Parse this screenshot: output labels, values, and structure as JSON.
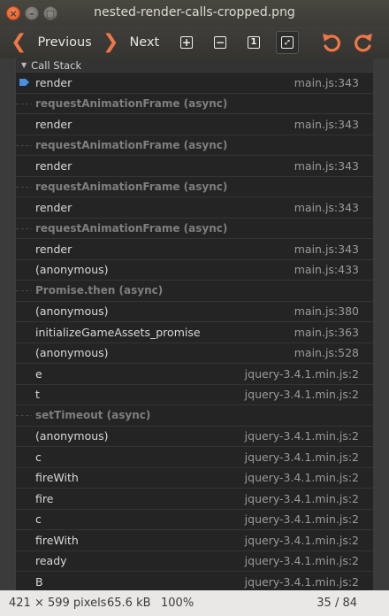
{
  "window": {
    "title": "nested-render-calls-cropped.png",
    "close_glyph": "×",
    "min_glyph": "–",
    "max_glyph": "□"
  },
  "toolbar": {
    "previous_label": "Previous",
    "next_label": "Next",
    "accent_color": "#f07746",
    "tools": [
      "zoom-in-icon",
      "zoom-out-icon",
      "normal-size-icon",
      "best-fit-icon"
    ],
    "rotate": [
      "rotate-left-icon",
      "rotate-right-icon"
    ]
  },
  "call_stack": {
    "header": "Call Stack",
    "frames": [
      {
        "name": "render",
        "location": "main.js:343",
        "type": "frame",
        "selected": true
      },
      {
        "name": "requestAnimationFrame (async)",
        "location": "",
        "type": "async"
      },
      {
        "name": "render",
        "location": "main.js:343",
        "type": "frame"
      },
      {
        "name": "requestAnimationFrame (async)",
        "location": "",
        "type": "async"
      },
      {
        "name": "render",
        "location": "main.js:343",
        "type": "frame"
      },
      {
        "name": "requestAnimationFrame (async)",
        "location": "",
        "type": "async"
      },
      {
        "name": "render",
        "location": "main.js:343",
        "type": "frame"
      },
      {
        "name": "requestAnimationFrame (async)",
        "location": "",
        "type": "async"
      },
      {
        "name": "render",
        "location": "main.js:343",
        "type": "frame"
      },
      {
        "name": "(anonymous)",
        "location": "main.js:433",
        "type": "frame"
      },
      {
        "name": "Promise.then (async)",
        "location": "",
        "type": "async"
      },
      {
        "name": "(anonymous)",
        "location": "main.js:380",
        "type": "frame"
      },
      {
        "name": "initializeGameAssets_promise",
        "location": "main.js:363",
        "type": "frame"
      },
      {
        "name": "(anonymous)",
        "location": "main.js:528",
        "type": "frame"
      },
      {
        "name": "e",
        "location": "jquery-3.4.1.min.js:2",
        "type": "frame"
      },
      {
        "name": "t",
        "location": "jquery-3.4.1.min.js:2",
        "type": "frame"
      },
      {
        "name": "setTimeout (async)",
        "location": "",
        "type": "async"
      },
      {
        "name": "(anonymous)",
        "location": "jquery-3.4.1.min.js:2",
        "type": "frame"
      },
      {
        "name": "c",
        "location": "jquery-3.4.1.min.js:2",
        "type": "frame"
      },
      {
        "name": "fireWith",
        "location": "jquery-3.4.1.min.js:2",
        "type": "frame"
      },
      {
        "name": "fire",
        "location": "jquery-3.4.1.min.js:2",
        "type": "frame"
      },
      {
        "name": "c",
        "location": "jquery-3.4.1.min.js:2",
        "type": "frame"
      },
      {
        "name": "fireWith",
        "location": "jquery-3.4.1.min.js:2",
        "type": "frame"
      },
      {
        "name": "ready",
        "location": "jquery-3.4.1.min.js:2",
        "type": "frame"
      },
      {
        "name": "B",
        "location": "jquery-3.4.1.min.js:2",
        "type": "frame"
      }
    ]
  },
  "status": {
    "dimensions": "421 × 599 pixels",
    "file_size": "65.6 kB",
    "zoom": "100%",
    "page": "35 / 84"
  }
}
